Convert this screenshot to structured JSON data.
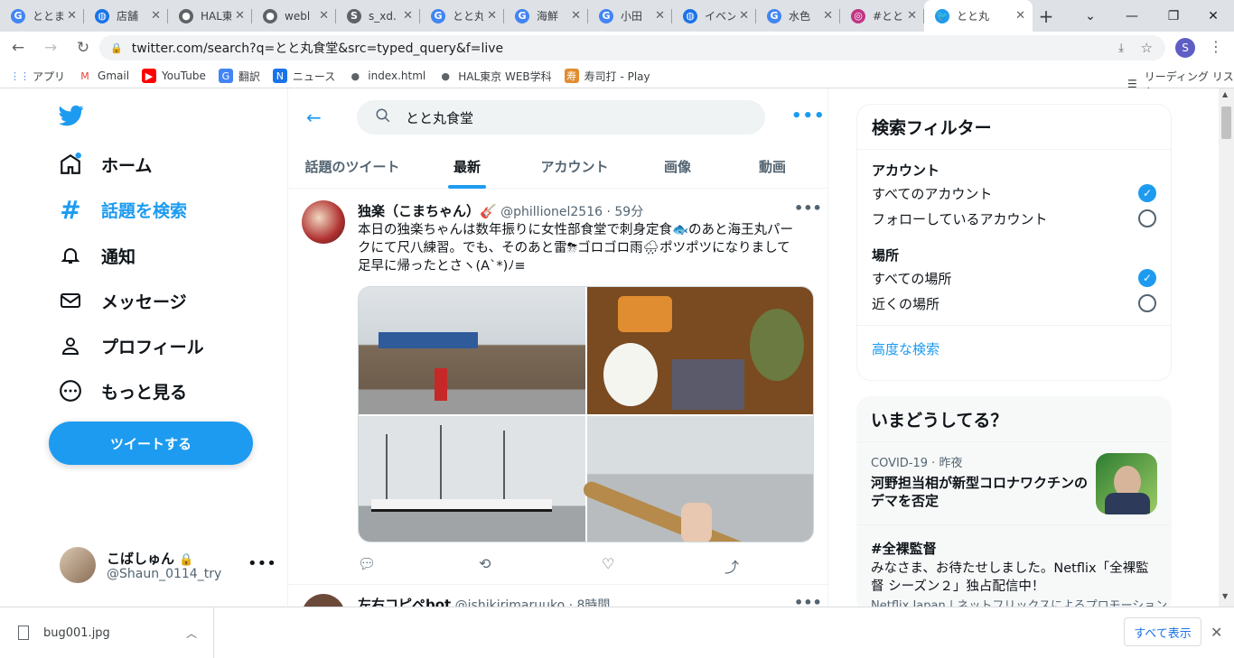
{
  "browser": {
    "tabs": [
      {
        "title": "ととま",
        "icon": "google-icon",
        "color": "#4285f4"
      },
      {
        "title": "店舗",
        "icon": "globe-icon",
        "color": "#1a73e8"
      },
      {
        "title": "HAL東",
        "icon": "world-icon",
        "color": "#5f6368"
      },
      {
        "title": "webl",
        "icon": "world-icon",
        "color": "#5f6368"
      },
      {
        "title": "s_xd.",
        "icon": "s-icon",
        "color": "#5f6368"
      },
      {
        "title": "とと丸",
        "icon": "google-icon",
        "color": "#4285f4"
      },
      {
        "title": "海鮮",
        "icon": "google-icon",
        "color": "#4285f4"
      },
      {
        "title": "小田",
        "icon": "google-icon",
        "color": "#4285f4"
      },
      {
        "title": "イベン",
        "icon": "globe-icon",
        "color": "#1a73e8"
      },
      {
        "title": "水色",
        "icon": "google-icon",
        "color": "#4285f4"
      },
      {
        "title": "#とと",
        "icon": "instagram-icon",
        "color": "#c13584"
      },
      {
        "title": "とと丸",
        "icon": "twitter-icon",
        "color": "#1d9bf0"
      }
    ],
    "url": "twitter.com/search?q=とと丸食堂&src=typed_query&f=live",
    "profile_initial": "S",
    "bookmarks": [
      {
        "label": "アプリ",
        "icon": "apps-icon"
      },
      {
        "label": "Gmail",
        "icon": "gmail-icon"
      },
      {
        "label": "YouTube",
        "icon": "youtube-icon"
      },
      {
        "label": "翻訳",
        "icon": "translate-icon"
      },
      {
        "label": "ニュース",
        "icon": "news-icon"
      },
      {
        "label": "index.html",
        "icon": "world-icon"
      },
      {
        "label": "HAL東京 WEB学科",
        "icon": "world-icon"
      },
      {
        "label": "寿司打 - Play",
        "icon": "sushi-icon"
      }
    ],
    "reading_list": "リーディング リスト"
  },
  "sidebar": {
    "items": [
      {
        "label": "ホーム",
        "icon": "home-icon"
      },
      {
        "label": "話題を検索",
        "icon": "hashtag-icon"
      },
      {
        "label": "通知",
        "icon": "bell-icon"
      },
      {
        "label": "メッセージ",
        "icon": "mail-icon"
      },
      {
        "label": "プロフィール",
        "icon": "person-icon"
      },
      {
        "label": "もっと見る",
        "icon": "more-circle-icon"
      }
    ],
    "tweet_button": "ツイートする",
    "account": {
      "name": "こばしゅん",
      "handle": "@Shaun_0114_try"
    }
  },
  "search": {
    "query": "とと丸食堂",
    "tabs": [
      "話題のツイート",
      "最新",
      "アカウント",
      "画像",
      "動画"
    ],
    "active_tab": "最新"
  },
  "tweets": [
    {
      "name": "独楽（こまちゃん）🎸",
      "handle": "@phillionel2516",
      "time": "59分",
      "text_line1": "本日の独楽ちゃんは数年振りに女性部食堂で刺身定食🐟のあと海王丸パー",
      "text_line2": "クにて尺八練習。でも、そのあと雷⛈ゴロゴロ雨🌧ポツポツになりまして",
      "text_line3": "足早に帰ったとさヽ(A`*)ﾉ≡"
    },
    {
      "name": "左右コピペbot",
      "handle": "@ishikirimaruuko",
      "time": "8時間"
    }
  ],
  "right": {
    "filter_title": "検索フィルター",
    "account_section": "アカウント",
    "account_options": [
      "すべてのアカウント",
      "フォローしているアカウント"
    ],
    "place_section": "場所",
    "place_options": [
      "すべての場所",
      "近くの場所"
    ],
    "advanced": "高度な検索",
    "trends_title": "いまどうしてる？",
    "trends": [
      {
        "meta": "COVID-19 · 昨夜",
        "title": "河野担当相が新型コロナワクチンのデマを否定"
      },
      {
        "meta": "",
        "title": "#全裸監督",
        "text": "みなさま、お待たせしました。Netflix「全裸監督 シーズン２」独占配信中！",
        "sub": "Netflix Japan | ネットフリックスによるプロモーション"
      }
    ]
  },
  "downloads": {
    "file": "bug001.jpg",
    "show_all": "すべて表示"
  }
}
